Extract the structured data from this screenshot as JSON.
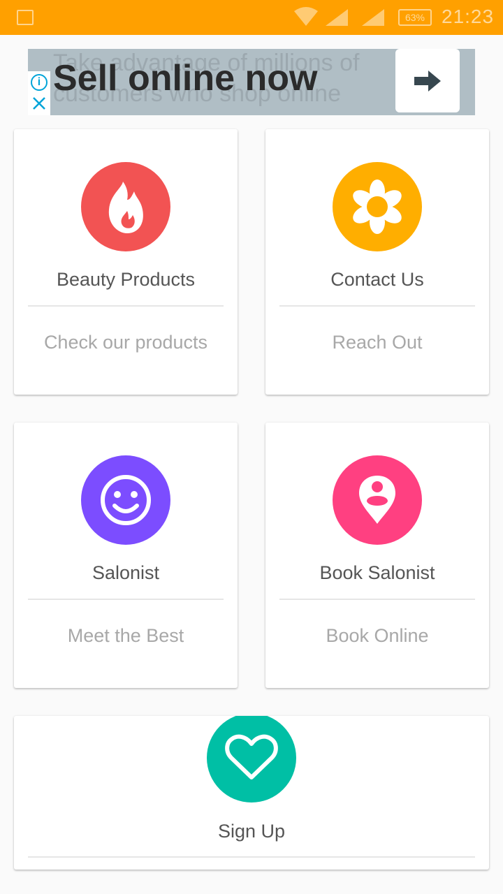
{
  "status_bar": {
    "battery": "63%",
    "time": "21:23"
  },
  "ad": {
    "headline": "Sell online now",
    "background_text": "Take advantage of millions of customers who shop online"
  },
  "cards": [
    {
      "title": "Beauty Products",
      "subtitle": "Check our products",
      "icon": "flame-icon",
      "color": "#f25353"
    },
    {
      "title": "Contact Us",
      "subtitle": "Reach Out",
      "icon": "flower-icon",
      "color": "#ffae00"
    },
    {
      "title": "Salonist",
      "subtitle": "Meet the Best",
      "icon": "smiley-icon",
      "color": "#7c4dff"
    },
    {
      "title": "Book Salonist",
      "subtitle": "Book Online",
      "icon": "location-person-icon",
      "color": "#ff4081"
    },
    {
      "title": "Sign Up",
      "icon": "heart-icon",
      "color": "#00bfa5"
    }
  ],
  "colors": {
    "status_bar": "#ffa000",
    "ad_background": "#b0bec5"
  }
}
